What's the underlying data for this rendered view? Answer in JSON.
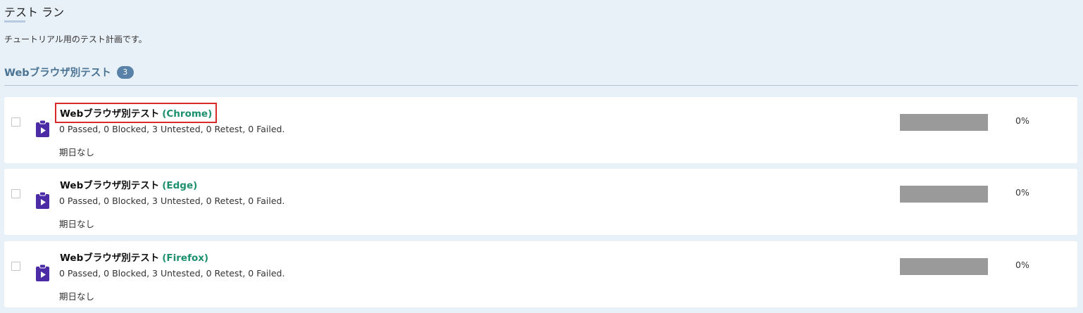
{
  "page": {
    "title": "テスト ラン",
    "description": "チュートリアル用のテスト計画です。"
  },
  "group": {
    "title": "Webブラウザ別テスト",
    "count": "3"
  },
  "runs": [
    {
      "name": "Webブラウザ別テスト",
      "browser": "(Chrome)",
      "stats": "0 Passed, 0 Blocked, 3 Untested, 0 Retest, 0 Failed.",
      "due": "期日なし",
      "progress_percent": 0,
      "progress_label": "0%",
      "highlighted": true
    },
    {
      "name": "Webブラウザ別テスト",
      "browser": "(Edge)",
      "stats": "0 Passed, 0 Blocked, 3 Untested, 0 Retest, 0 Failed.",
      "due": "期日なし",
      "progress_percent": 0,
      "progress_label": "0%",
      "highlighted": false
    },
    {
      "name": "Webブラウザ別テスト",
      "browser": "(Firefox)",
      "stats": "0 Passed, 0 Blocked, 3 Untested, 0 Retest, 0 Failed.",
      "due": "期日なし",
      "progress_percent": 0,
      "progress_label": "0%",
      "highlighted": false
    }
  ],
  "colors": {
    "page_background": "#e8f0f8",
    "group_title": "#4a7394",
    "browser_label": "#1c8f6c",
    "run_icon": "#4b2ca6",
    "highlight_border": "#d92a2a",
    "progress_empty": "#9a9a9a"
  },
  "icons": {
    "run_icon": "clipboard-play-icon"
  }
}
